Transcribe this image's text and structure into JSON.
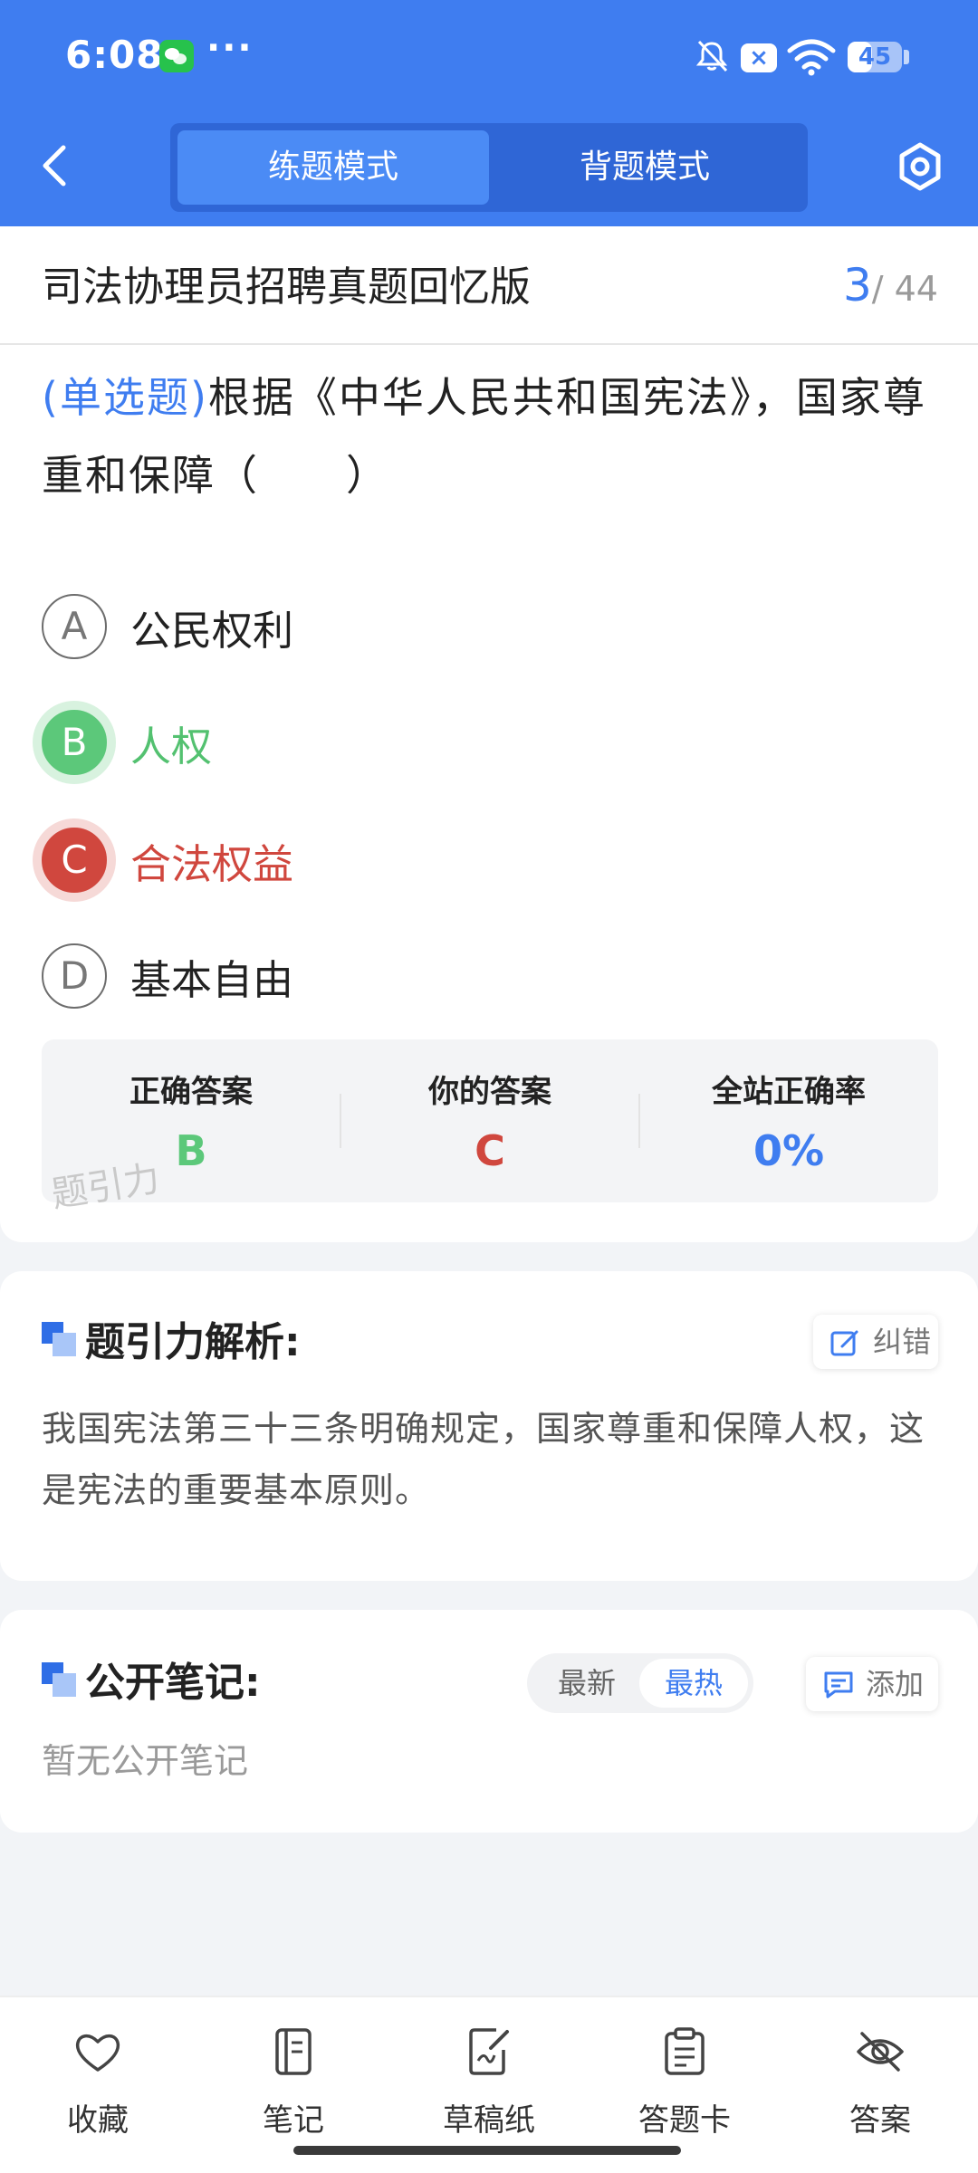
{
  "status_bar": {
    "time": "6:08",
    "notification_icons": [
      "wechat-icon",
      "more-icon"
    ],
    "system_icons": [
      "bell-muted-icon",
      "close-box-icon",
      "wifi-icon",
      "battery-icon"
    ],
    "more": "···",
    "x_label": "×",
    "battery": "45",
    "battery_level": 0.45
  },
  "header": {
    "tabs": [
      {
        "label": "练题模式",
        "active": true
      },
      {
        "label": "背题模式",
        "active": false
      }
    ]
  },
  "paper": {
    "title": "司法协理员招聘真题回忆版",
    "current": "3",
    "sep_total": "/ 44"
  },
  "question": {
    "type": "(单选题)",
    "text": "根据《中华人民共和国宪法》，国家尊重和保障（　　）"
  },
  "options": [
    {
      "letter": "A",
      "text": "公民权利",
      "state": "normal"
    },
    {
      "letter": "B",
      "text": "人权",
      "state": "correct"
    },
    {
      "letter": "C",
      "text": "合法权益",
      "state": "wrong"
    },
    {
      "letter": "D",
      "text": "基本自由",
      "state": "normal"
    }
  ],
  "answer_summary": {
    "correct_label": "正确答案",
    "correct_value": "B",
    "yours_label": "你的答案",
    "yours_value": "C",
    "rate_label": "全站正确率",
    "rate_value": "0%",
    "watermark": "题引力"
  },
  "analysis": {
    "title": "题引力解析:",
    "report_label": "纠错",
    "text": "我国宪法第三十三条明确规定，国家尊重和保障人权，这是宪法的重要基本原则。"
  },
  "notes": {
    "title": "公开笔记:",
    "sort_options": [
      "最新",
      "最热"
    ],
    "sort_selected": "最热",
    "add_label": "添加",
    "empty": "暂无公开笔记"
  },
  "bottom_nav": [
    {
      "label": "收藏",
      "icon": "heart-icon"
    },
    {
      "label": "笔记",
      "icon": "notebook-icon"
    },
    {
      "label": "草稿纸",
      "icon": "draft-paper-icon"
    },
    {
      "label": "答题卡",
      "icon": "answer-card-icon"
    },
    {
      "label": "答案",
      "icon": "eye-off-icon"
    }
  ],
  "colors": {
    "primary": "#3f7df0",
    "correct": "#5cc87a",
    "wrong": "#d0473e"
  }
}
